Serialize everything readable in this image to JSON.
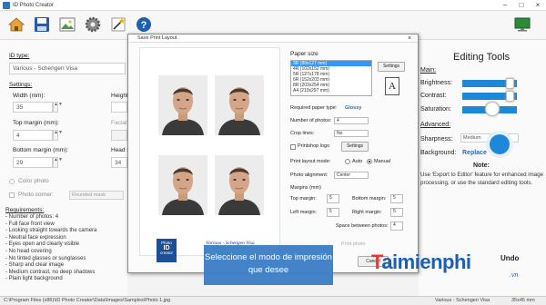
{
  "app": {
    "title": "ID Photo Creator"
  },
  "toolbar": {
    "icons": [
      "home-icon",
      "save-icon",
      "gear-icon",
      "magic-wand-icon",
      "help-icon"
    ]
  },
  "left": {
    "id_type_label": "ID type:",
    "id_type_value": "Various - Schengen Visa",
    "settings_label": "Settings:",
    "width_label": "Width (mm):",
    "width_value": "35",
    "height_label": "Height",
    "top_margin_label": "Top margin (mm):",
    "top_margin_value": "4",
    "facial_label": "Facial",
    "bottom_margin_label": "Bottom margin (mm):",
    "bottom_margin_value": "29",
    "head_label": "Head s",
    "head_value": "34",
    "color_photo_label": "Color photo",
    "photo_corner_label": "Photo corner:",
    "photo_corner_value": "Rounded mask",
    "requirements_title": "Requirements:",
    "requirements": [
      "- Number of photos: 4",
      "- Full face front view",
      "- Looking straight towards the camera",
      "- Neutral face expression",
      "- Eyes open and clearly visible",
      "- No head covering",
      "- No tinted glasses or sunglasses",
      "- Sharp and clear image",
      "- Medium contrast, no deep shadows",
      "- Plain light background"
    ]
  },
  "status": {
    "path": "C:\\Program Files (x86)\\ID Photo Creator\\Data\\Images\\Samples\\Photo 1.jpg",
    "id_type": "Various - Schengen Visa",
    "size": "35x45 mm"
  },
  "right": {
    "title": "Editing Tools",
    "main_label": "Main:",
    "brightness_label": "Brightness:",
    "contrast_label": "Contrast:",
    "saturation_label": "Saturation:",
    "advanced_label": "Advanced:",
    "sharpness_label": "Sharpness:",
    "sharpness_value": "Medium",
    "background_label": "Background:",
    "background_value": "Replace",
    "note_title": "Note:",
    "note_text": "Use 'Export to Editor' feature for enhanced image processing, or use the standard editing tools.",
    "undo_label": "Undo",
    "brightness_level": 0.87,
    "contrast_level": 0.87,
    "saturation_level": 0.55
  },
  "dialog": {
    "title": "Save Print Layout",
    "paper_size_label": "Paper size",
    "paper_sizes": [
      "3R (89x127 mm)",
      "4R (102x152 mm)",
      "5R (127x178 mm)",
      "6R (152x203 mm)",
      "8R (203x254 mm)",
      "A4 (210x297 mm)"
    ],
    "selected_paper": "3R (89x127 mm)",
    "settings_button": "Settings",
    "required_paper_label": "Required paper type:",
    "required_paper_value": "Glossy",
    "num_photos_label": "Number of photos:",
    "num_photos_value": "4",
    "crop_lines_label": "Crop lines:",
    "crop_lines_value": "No",
    "printshop_logo_label": "Printshop logo",
    "printshop_settings_button": "Settings",
    "print_layout_mode_label": "Print layout mode:",
    "mode_auto": "Auto",
    "mode_manual": "Manual",
    "photo_alignment_label": "Photo alignment:",
    "photo_alignment_value": "Center",
    "margins_label": "Margins (mm)",
    "top_margin_label": "Top margin:",
    "top_margin_value": "5",
    "bottom_margin_label": "Bottom margin:",
    "bottom_margin_value": "5",
    "left_margin_label": "Left margin:",
    "left_margin_value": "5",
    "right_margin_label": "Right margin:",
    "right_margin_value": "5",
    "spacing_label": "Space between photos:",
    "spacing_value": "4",
    "print_photo_label": "Print photo",
    "cancel_button": "Cancel",
    "caption_line1": "Various - Schengen Visa",
    "caption_line2": "3R (89x127 mm)",
    "caption_line3": "2016.06.09",
    "logo_line1": "Photo",
    "logo_line2": "ID",
    "logo_line3": "creator",
    "page_icon_letter": "A"
  },
  "overlay": {
    "tip_text": "Seleccione el modo de impresión que desee",
    "watermark": "Taimienphi",
    "watermark_suffix": ".vn"
  },
  "colors": {
    "accent": "#1e88d8",
    "tip_bg": "#3d7fc5",
    "watermark": "#1a5fb4"
  }
}
